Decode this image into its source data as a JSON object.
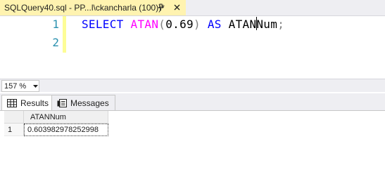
{
  "tab": {
    "title": "SQLQuery40.sql - PP...l\\ckancharla (100))*",
    "pin_icon": "pin-icon",
    "close_icon": "close-icon"
  },
  "editor": {
    "line_numbers": [
      "1",
      "2"
    ],
    "tokens": {
      "select": "SELECT",
      "func": "ATAN",
      "open_paren": "(",
      "arg": "0.69",
      "close_paren": ")",
      "as": "AS",
      "alias_a": "ATAN",
      "alias_b": "Num",
      "semicolon": ";"
    }
  },
  "status": {
    "zoom": "157 %"
  },
  "results_tabs": [
    {
      "label": "Results",
      "icon": "grid-icon"
    },
    {
      "label": "Messages",
      "icon": "messages-icon"
    }
  ],
  "grid": {
    "columns": [
      "ATANNum"
    ],
    "rows": [
      {
        "row_number": "1",
        "values": [
          "0.603982978252998"
        ]
      }
    ]
  },
  "colors": {
    "keyword": "#0000ff",
    "function": "#ff00ff",
    "operator": "#808080",
    "line_number": "#2b91af",
    "tab_modified": "#fff3b0"
  }
}
